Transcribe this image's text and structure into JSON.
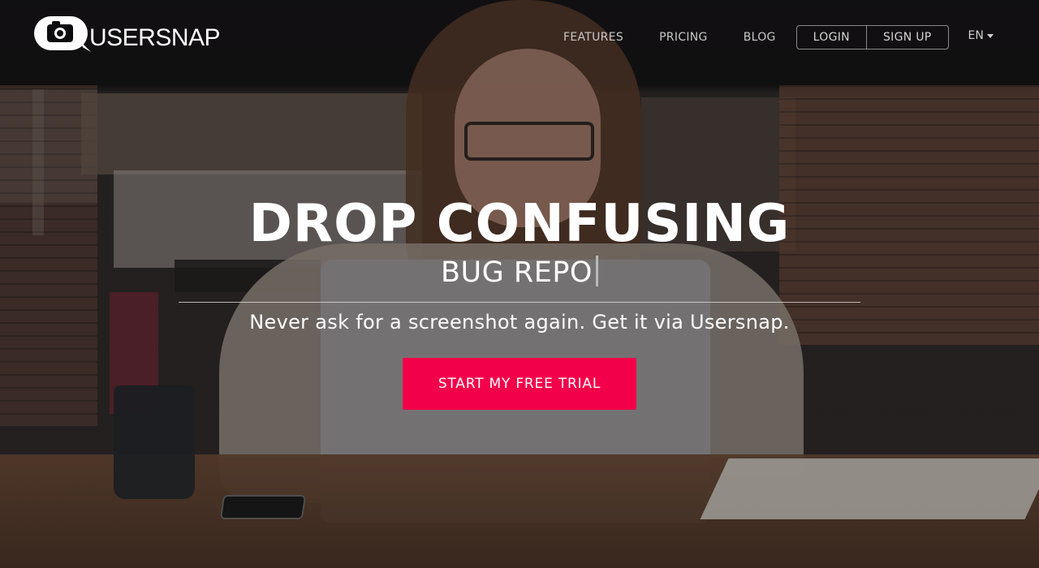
{
  "brand": {
    "name": "USERSNAP",
    "logo_icon": "camera-speech-bubble-icon"
  },
  "nav": {
    "links": [
      "FEATURES",
      "PRICING",
      "BLOG"
    ],
    "login_label": "LOGIN",
    "signup_label": "SIGN UP",
    "language": "EN",
    "language_icon": "caret-down-icon"
  },
  "hero": {
    "headline": "DROP CONFUSING",
    "subheadline": "BUG REPO",
    "tagline": "Never ask for a screenshot again. Get it via Usersnap.",
    "cta_label": "START MY FREE TRIAL"
  },
  "colors": {
    "cta_background": "#f3004a",
    "nav_background": "#0a0a0c",
    "text": "#ffffff"
  }
}
